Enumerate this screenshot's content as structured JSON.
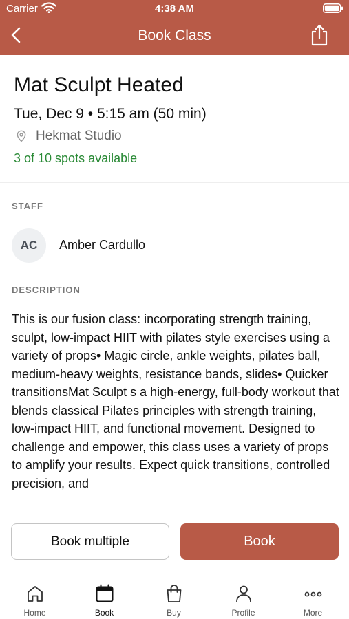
{
  "status_bar": {
    "carrier": "Carrier",
    "time": "4:38 AM"
  },
  "nav": {
    "title": "Book Class"
  },
  "class": {
    "title": "Mat Sculpt Heated",
    "datetime": "Tue, Dec 9 • 5:15 am (50 min)",
    "location": "Hekmat Studio",
    "spots": "3 of 10 spots available"
  },
  "staff": {
    "section_label": "STAFF",
    "initials": "AC",
    "name": "Amber Cardullo"
  },
  "description": {
    "section_label": "DESCRIPTION",
    "text": "This is our fusion class: incorporating strength training, sculpt, low-impact HIIT with pilates style exercises using a variety of props• Magic circle, ankle weights, pilates ball, medium-heavy weights, resistance bands, slides• Quicker transitionsMat Sculpt s a high-energy, full-body workout that blends classical Pilates principles with strength training, low-impact HIIT, and functional movement. Designed to challenge and empower, this class uses a variety of props to amplify your results. Expect quick transitions, controlled precision, and"
  },
  "actions": {
    "book_multiple_label": "Book multiple",
    "book_label": "Book"
  },
  "tabs": [
    {
      "label": "Home",
      "icon": "home-icon"
    },
    {
      "label": "Book",
      "icon": "calendar-icon"
    },
    {
      "label": "Buy",
      "icon": "shopping-bag-icon"
    },
    {
      "label": "Profile",
      "icon": "person-icon"
    },
    {
      "label": "More",
      "icon": "more-dots-icon"
    }
  ],
  "colors": {
    "brand": "#b85a47",
    "available": "#2a8a36"
  }
}
